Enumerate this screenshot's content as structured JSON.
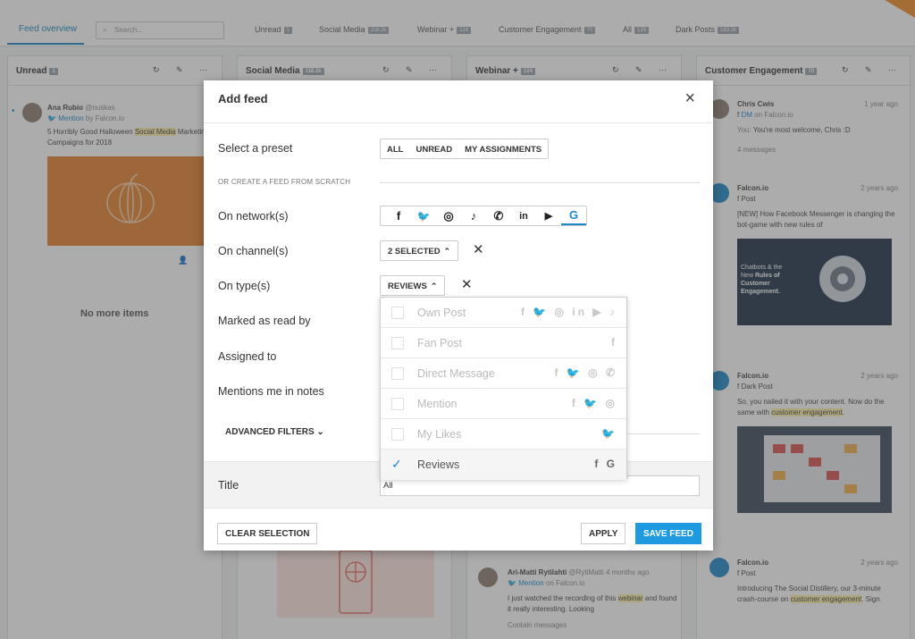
{
  "topbar": {
    "active_tab": "Feed overview",
    "search_placeholder": "Search...",
    "tabs": [
      {
        "label": "Unread",
        "count": "1"
      },
      {
        "label": "Social Media",
        "count": "118.2k"
      },
      {
        "label": "Webinar +",
        "count": "124"
      },
      {
        "label": "Customer Engagement",
        "count": "70"
      },
      {
        "label": "All",
        "count": "139"
      },
      {
        "label": "Dark Posts",
        "count": "183.2k"
      }
    ]
  },
  "columns": {
    "unread": {
      "title": "Unread",
      "count": "1",
      "post": {
        "author": "Ana Rubio",
        "handle": "@nuskas",
        "type": "Mention",
        "via": "by Falcon.io",
        "text_pre": "5 Horribly Good Halloween ",
        "text_hl": "Social Media",
        "text_post": " Marketing Campaigns for 2018"
      },
      "no_more": "No more items"
    },
    "social": {
      "title": "Social Media",
      "count": "118.2k"
    },
    "webinar": {
      "title": "Webinar +",
      "count": "124",
      "post": {
        "author": "Ari-Matti Rytilahti",
        "handle": "@RytiMatti",
        "time": "4 months ago",
        "type": "Mention",
        "via": "on Falcon.io",
        "text_pre": "I just watched the recording of this ",
        "text_hl": "webinar",
        "text_post": " and found it really interesting. Looking",
        "footer": "Contain messages"
      }
    },
    "customer": {
      "title": "Customer Engagement",
      "count": "70",
      "posts": [
        {
          "author": "Chris Cwis",
          "time": "1 year ago",
          "type": "DM",
          "via": "on Falcon.io",
          "text_pre": "You: ",
          "text": "You're most welcome, Chris :D",
          "footer": "4 messages"
        },
        {
          "author": "Falcon.io",
          "time": "2 years ago",
          "type": "Post",
          "text": "[NEW] How Facebook Messenger is changing the bot-game with new rules of",
          "image_text_1": "Chatbots & the New",
          "image_text_2": "Rules of Customer Engagement."
        },
        {
          "author": "Falcon.io",
          "time": "2 years ago",
          "type": "Dark Post",
          "text_pre": "So, you nailed it with your content. Now do the same with ",
          "text_hl": "customer engagement",
          "text_post": "."
        },
        {
          "author": "Falcon.io",
          "time": "2 years ago",
          "type": "Post",
          "text_pre": "Introducing The Social Distillery, our 3-minute crash-course on ",
          "text_hl": "customer engagement",
          "text_post": ". Sign"
        }
      ]
    }
  },
  "modal": {
    "title": "Add feed",
    "labels": {
      "preset": "Select a preset",
      "scratch": "OR CREATE A FEED FROM SCRATCH",
      "networks": "On network(s)",
      "channels": "On channel(s)",
      "types": "On type(s)",
      "marked": "Marked as read by",
      "assigned": "Assigned to",
      "mentions": "Mentions me in notes",
      "advanced": "ADVANCED FILTERS",
      "title": "Title"
    },
    "presets": [
      "ALL",
      "UNREAD",
      "MY ASSIGNMENTS"
    ],
    "networks": [
      {
        "name": "facebook-icon",
        "glyph": "f"
      },
      {
        "name": "twitter-icon",
        "glyph": "🐦"
      },
      {
        "name": "instagram-icon",
        "glyph": "◎"
      },
      {
        "name": "tiktok-icon",
        "glyph": "♪"
      },
      {
        "name": "whatsapp-icon",
        "glyph": "✆"
      },
      {
        "name": "linkedin-icon",
        "glyph": "in"
      },
      {
        "name": "youtube-icon",
        "glyph": "▶"
      },
      {
        "name": "google-icon",
        "glyph": "G",
        "selected": true
      }
    ],
    "channels_value": "2 SELECTED",
    "types_value": "REVIEWS",
    "type_options": [
      {
        "label": "Own Post",
        "icons": "f 🐦 ◎ in ▶ ♪",
        "checked": false
      },
      {
        "label": "Fan Post",
        "icons": "f",
        "checked": false
      },
      {
        "label": "Direct Message",
        "icons": "f 🐦 ◎ ✆",
        "checked": false
      },
      {
        "label": "Mention",
        "icons": "f 🐦 ◎",
        "checked": false
      },
      {
        "label": "My Likes",
        "icons": "🐦",
        "checked": false
      },
      {
        "label": "Reviews",
        "icons": "f G",
        "checked": true
      }
    ],
    "title_value": "All",
    "buttons": {
      "clear": "CLEAR SELECTION",
      "apply": "APPLY",
      "save": "SAVE FEED"
    }
  },
  "colors": {
    "accent": "#1e88c7",
    "primary_button": "#1e9be0",
    "highlight": "#fff1a8",
    "brand_orange": "#f28c28"
  }
}
